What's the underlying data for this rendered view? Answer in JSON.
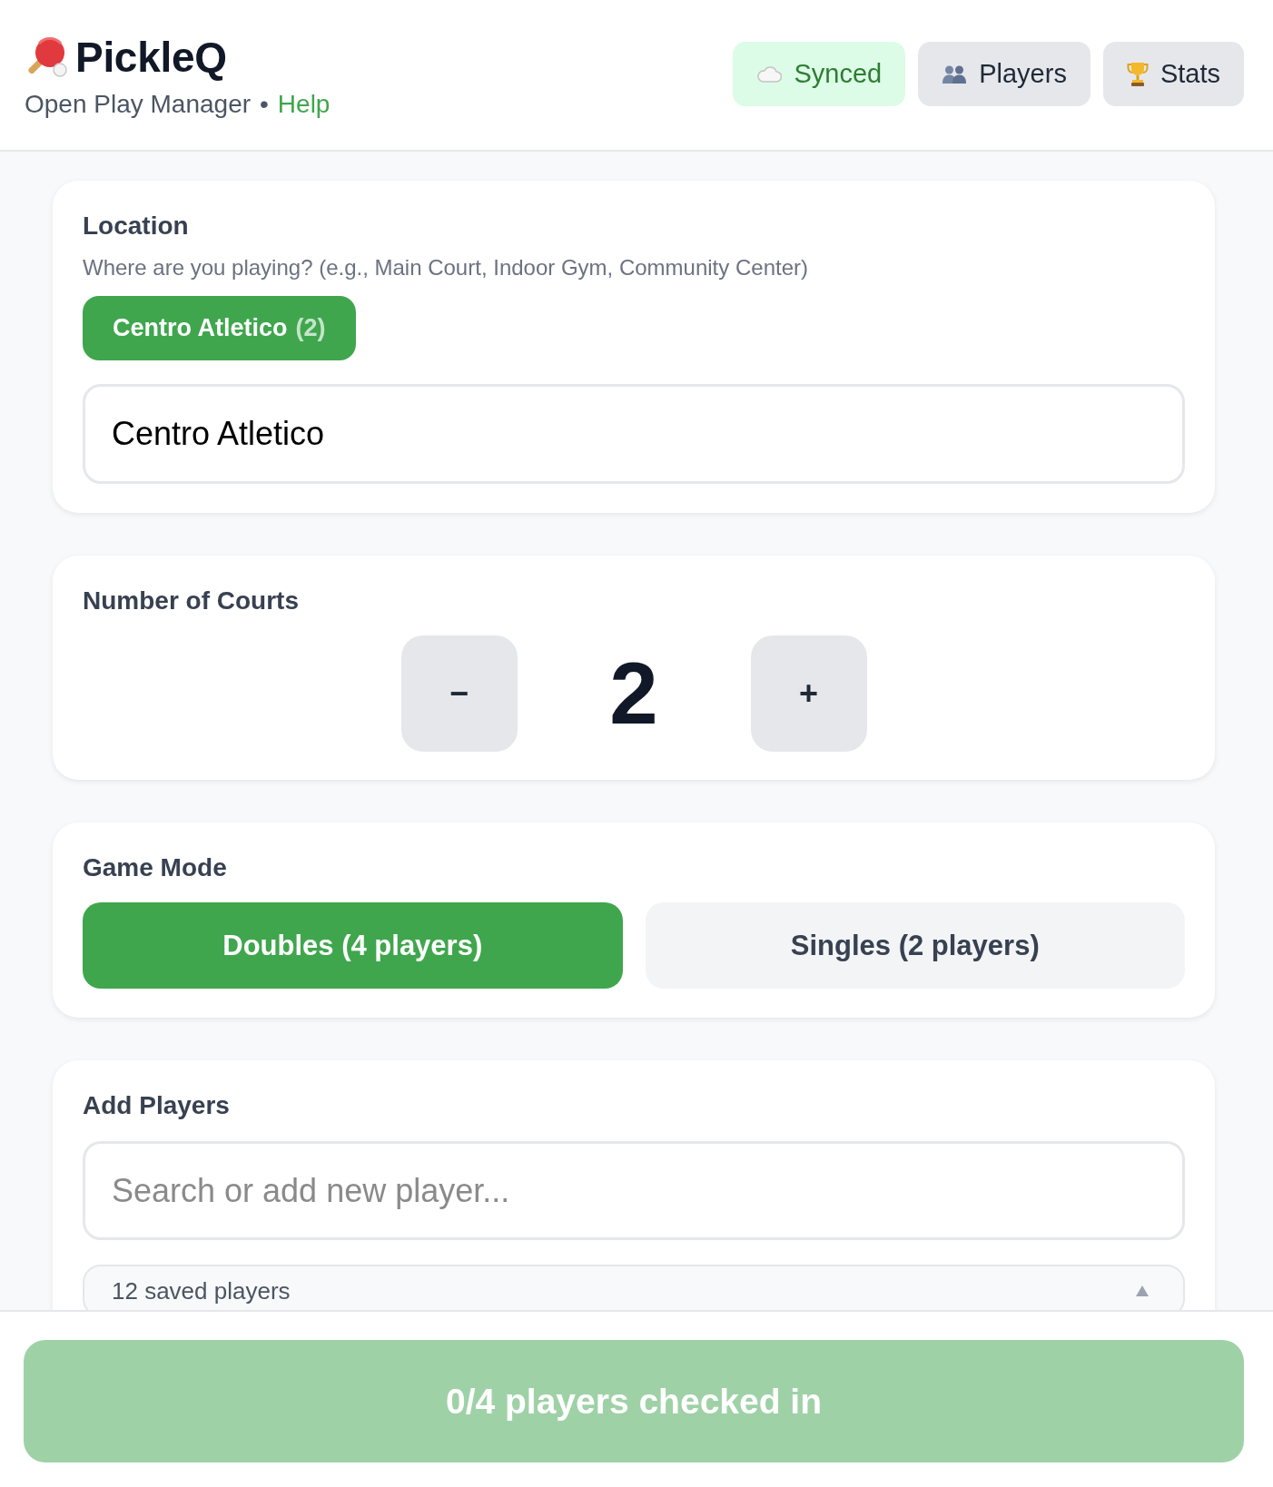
{
  "header": {
    "title": "PickleQ",
    "subtitle": "Open Play Manager",
    "separator": "•",
    "help_link": "Help",
    "buttons": [
      {
        "kind": "sync",
        "label": "Synced"
      },
      {
        "kind": "players",
        "label": "Players"
      },
      {
        "kind": "stats",
        "label": "Stats"
      }
    ]
  },
  "location": {
    "title": "Location",
    "hint": "Where are you playing? (e.g., Main Court, Indoor Gym, Community Center)",
    "chips": [
      {
        "label": "Centro Atletico",
        "count": "(2)",
        "selected": true
      }
    ],
    "value": "Centro Atletico"
  },
  "courts": {
    "title": "Number of Courts",
    "decrement": "−",
    "count": "2",
    "increment": "+"
  },
  "game_mode": {
    "title": "Game Mode",
    "options": [
      {
        "label": "Doubles (4 players)",
        "selected": true
      },
      {
        "label": "Singles (2 players)",
        "selected": false
      }
    ]
  },
  "add_players": {
    "title": "Add Players",
    "search": {
      "placeholder": "Search or add new player..."
    },
    "saved_players": {
      "label": "12 saved players",
      "expanded": true
    }
  },
  "footer": {
    "check_in_button": {
      "label": "0/4 players checked in",
      "disabled": true
    }
  }
}
